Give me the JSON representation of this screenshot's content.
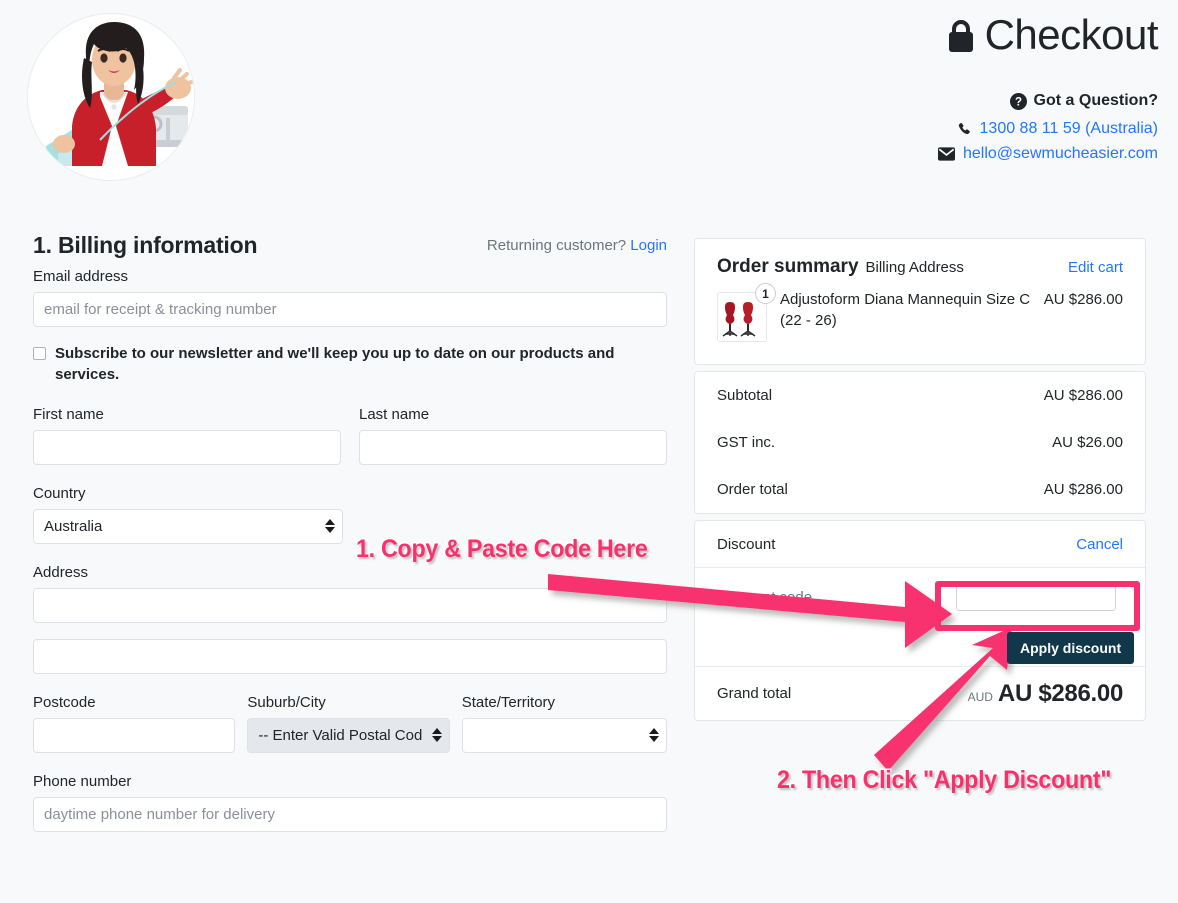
{
  "header": {
    "title": "Checkout",
    "lock_icon": "lock-icon",
    "question_label": "Got a Question?",
    "question_icon": "question-circle-icon",
    "phone_icon": "phone-icon",
    "phone": "1300 88 11 59 (Australia)",
    "email_icon": "envelope-icon",
    "email": "hello@sewmucheasier.com",
    "avatar_icon": "avatar-logo"
  },
  "billing": {
    "title": "1. Billing information",
    "returning_text": "Returning customer?",
    "login_label": "Login",
    "email_label": "Email address",
    "email_placeholder": "email for receipt & tracking number",
    "email_value": "",
    "newsletter_text": "Subscribe to our newsletter and we'll keep you up to date on our products and services.",
    "newsletter_checked": false,
    "first_name_label": "First name",
    "first_name_value": "",
    "last_name_label": "Last name",
    "last_name_value": "",
    "country_label": "Country",
    "country_value": "Australia",
    "address_label": "Address",
    "address1_value": "",
    "address2_value": "",
    "postcode_label": "Postcode",
    "postcode_value": "",
    "suburb_label": "Suburb/City",
    "suburb_value": "-- Enter Valid Postal Cod",
    "state_label": "State/Territory",
    "state_value": "",
    "phone_label": "Phone number",
    "phone_placeholder": "daytime phone number for delivery",
    "phone_value": ""
  },
  "summary": {
    "title": "Order summary",
    "subtitle": "Billing Address",
    "edit_cart_label": "Edit cart",
    "item": {
      "name": "Adjustoform Diana Mannequin Size C (22 - 26)",
      "price": "AU $286.00",
      "quantity": "1",
      "thumb_icon": "mannequin-thumbnail"
    },
    "totals": [
      {
        "label": "Subtotal",
        "value": "AU $286.00"
      },
      {
        "label": "GST inc.",
        "value": "AU $26.00"
      },
      {
        "label": "Order total",
        "value": "AU $286.00"
      }
    ],
    "discount": {
      "label": "Discount",
      "cancel_label": "Cancel",
      "code_label": "Discount code",
      "code_value": "",
      "apply_label": "Apply discount"
    },
    "grand": {
      "label": "Grand total",
      "currency": "AUD",
      "amount": "AU $286.00"
    }
  },
  "annotations": {
    "step1": "1. Copy & Paste Code Here",
    "step2": "2. Then Click \"Apply Discount\"",
    "accent_color": "#f8306e",
    "arrow1_icon": "arrow-right-annotation",
    "arrow2_icon": "arrow-up-right-annotation",
    "highlight_icon": "highlight-box-annotation"
  },
  "colors": {
    "link": "#2176ff",
    "accent_pink": "#f8306e",
    "button_dark": "#10384a",
    "page_bg": "#f8f9fa"
  }
}
